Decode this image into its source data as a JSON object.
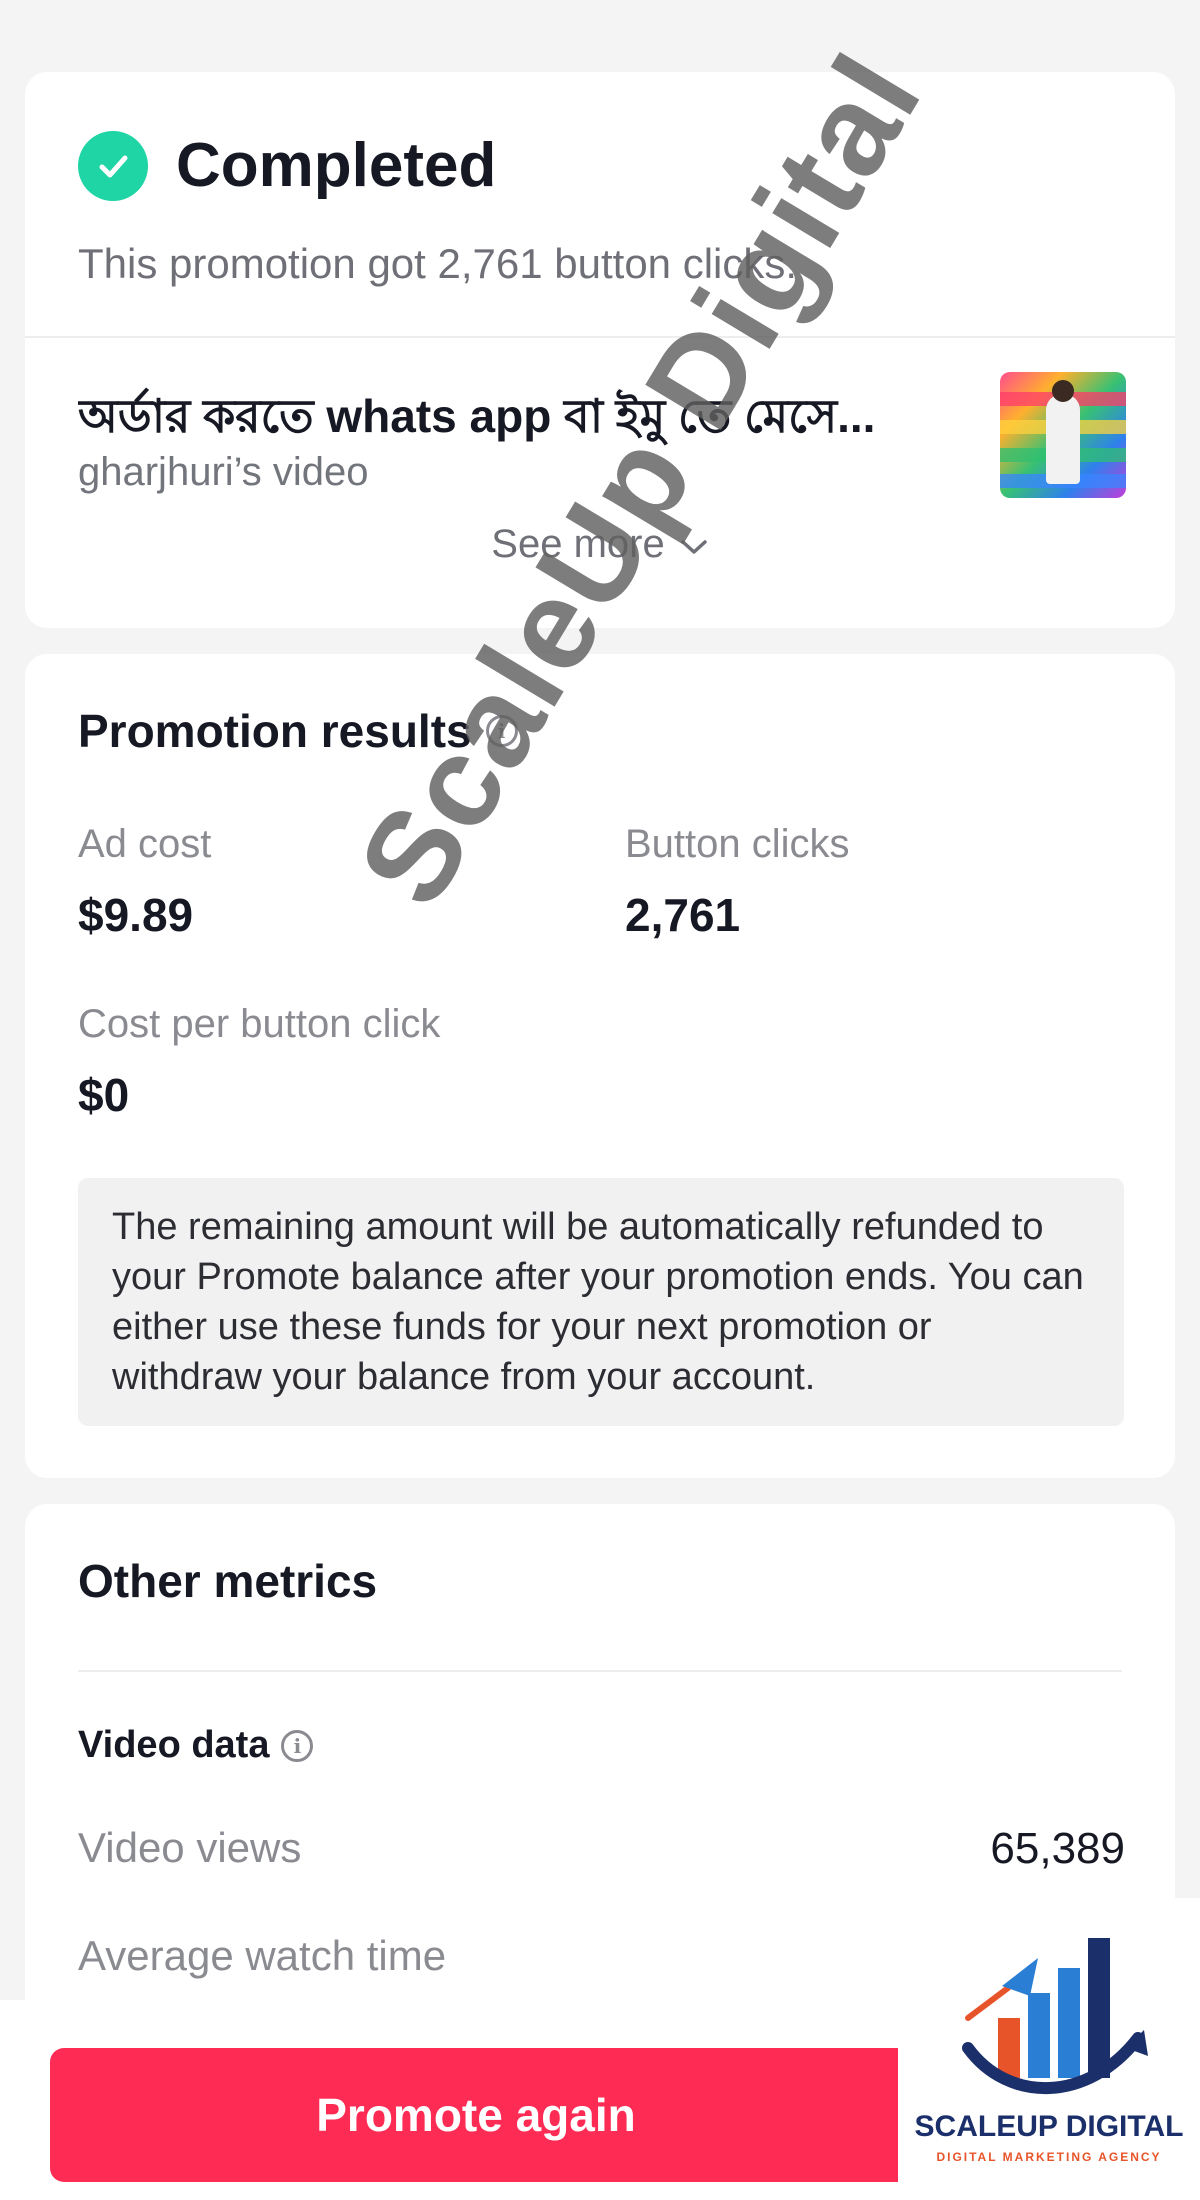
{
  "status_card": {
    "status": "Completed",
    "summary": "This promotion got 2,761 button clicks.",
    "video_title": "অর্ডার করতে whats app বা ইমু তে মেসে...",
    "video_owner": "gharjhuri’s video",
    "see_more": "See more"
  },
  "results_card": {
    "title": "Promotion results",
    "ad_cost_label": "Ad cost",
    "ad_cost_value": "$9.89",
    "button_clicks_label": "Button clicks",
    "button_clicks_value": "2,761",
    "cost_per_click_label": "Cost per button click",
    "cost_per_click_value": "$0",
    "notice": "The remaining amount will be automatically refunded to your Promote balance after your promotion ends. You can either use these funds for your next promotion or withdraw your balance from your account."
  },
  "metrics_card": {
    "title": "Other metrics",
    "section": "Video data",
    "rows": [
      {
        "label": "Video views",
        "value": "65,389"
      },
      {
        "label": "Average watch time",
        "value": ""
      }
    ]
  },
  "footer": {
    "promote_button": "Promote again"
  },
  "watermark": "ScaleUp Digital",
  "logo": {
    "name": "SCALEUP DIGITAL",
    "tagline": "DIGITAL MARKETING AGENCY"
  },
  "colors": {
    "accent": "#fe2c55",
    "success": "#20d5a5",
    "logo_blue": "#1b2f6b",
    "logo_orange": "#e8542a"
  }
}
